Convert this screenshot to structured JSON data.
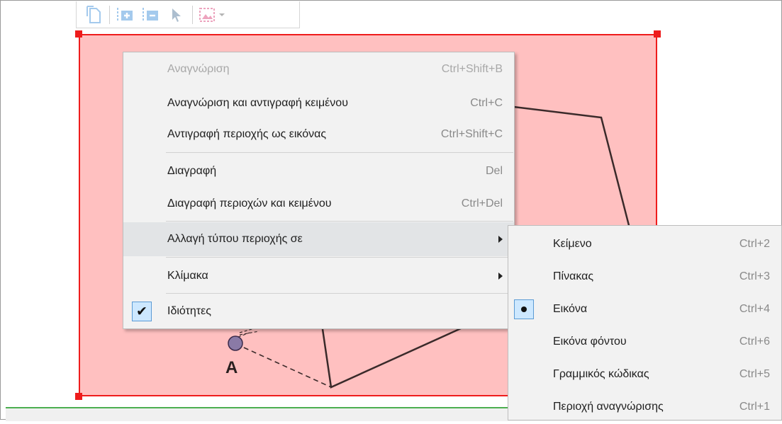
{
  "toolbar": {
    "buttons": [
      {
        "icon": "page-layout-icon"
      },
      {
        "icon": "add-region-icon"
      },
      {
        "icon": "remove-region-icon"
      },
      {
        "icon": "select-pointer-icon"
      },
      {
        "icon": "picture-region-icon"
      }
    ]
  },
  "canvas": {
    "point_label": "A",
    "region_color": "#ffc0c0",
    "region_border": "#ee1c1c"
  },
  "context_menu": {
    "items": [
      {
        "label": "Αναγνώριση",
        "shortcut": "Ctrl+Shift+B",
        "disabled": true
      },
      {
        "label": "Αναγνώριση και αντιγραφή κειμένου",
        "shortcut": "Ctrl+C"
      },
      {
        "label": "Αντιγραφή περιοχής ως εικόνας",
        "shortcut": "Ctrl+Shift+C"
      },
      {
        "label": "Διαγραφή",
        "shortcut": "Del"
      },
      {
        "label": "Διαγραφή περιοχών και κειμένου",
        "shortcut": "Ctrl+Del"
      },
      {
        "label": "Αλλαγή τύπου περιοχής σε",
        "submenu": true,
        "highlighted": true
      },
      {
        "label": "Κλίμακα",
        "submenu": true
      },
      {
        "label": "Ιδιότητες",
        "checked": true
      }
    ]
  },
  "submenu": {
    "items": [
      {
        "label": "Κείμενο",
        "shortcut": "Ctrl+2"
      },
      {
        "label": "Πίνακας",
        "shortcut": "Ctrl+3"
      },
      {
        "label": "Εικόνα",
        "shortcut": "Ctrl+4",
        "selected": true
      },
      {
        "label": "Εικόνα φόντου",
        "shortcut": "Ctrl+6"
      },
      {
        "label": "Γραμμικός κώδικας",
        "shortcut": "Ctrl+5"
      },
      {
        "label": "Περιοχή αναγνώρισης",
        "shortcut": "Ctrl+1"
      }
    ]
  }
}
